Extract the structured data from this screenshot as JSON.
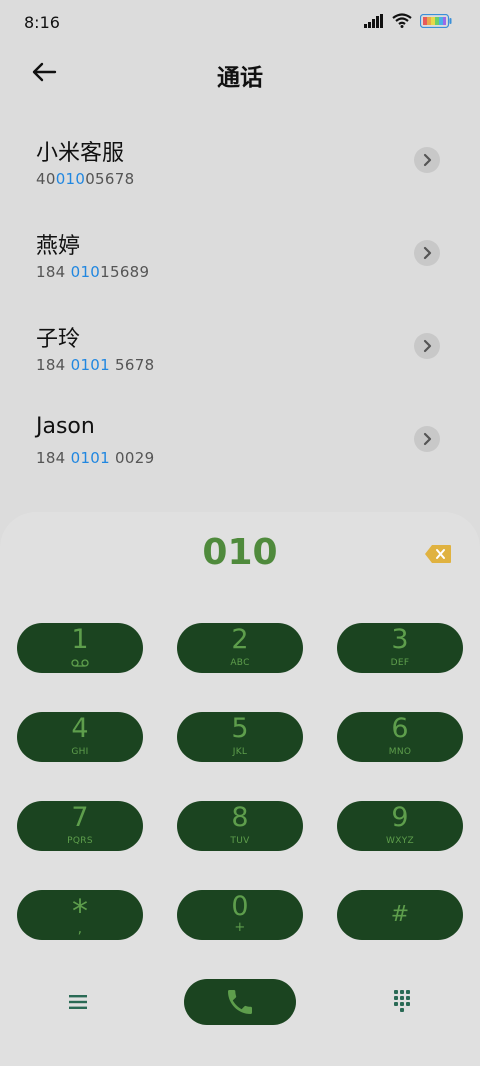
{
  "status": {
    "time": "8:16",
    "icons": [
      "signal-icon",
      "wifi-icon",
      "battery-icon"
    ]
  },
  "header": {
    "title": "通话",
    "back_icon": "arrow-left-icon"
  },
  "contacts": [
    {
      "name": "小米客服",
      "number_pre": "40",
      "number_hl": "010",
      "number_post": "05678"
    },
    {
      "name": "燕婷",
      "number_pre": "184 ",
      "number_hl": "010",
      "number_post": "15689"
    },
    {
      "name": "子玲",
      "number_pre": "184 ",
      "number_hl": "0101",
      "number_post": " 5678"
    },
    {
      "name": "Jason",
      "number_pre": "184 ",
      "number_hl": "0101",
      "number_post": " 0029"
    }
  ],
  "dialpad": {
    "digits": "010",
    "keys": [
      {
        "num": "1",
        "sub": ""
      },
      {
        "num": "2",
        "sub": "ABC"
      },
      {
        "num": "3",
        "sub": "DEF"
      },
      {
        "num": "4",
        "sub": "GHI"
      },
      {
        "num": "5",
        "sub": "JKL"
      },
      {
        "num": "6",
        "sub": "MNO"
      },
      {
        "num": "7",
        "sub": "PQRS"
      },
      {
        "num": "8",
        "sub": "TUV"
      },
      {
        "num": "9",
        "sub": "WXYZ"
      },
      {
        "num": "*",
        "sub": ","
      },
      {
        "num": "0",
        "sub": "+"
      },
      {
        "num": "#",
        "sub": ""
      }
    ]
  },
  "colors": {
    "key_bg": "#1b4420",
    "key_fg": "#5e9e4c",
    "digits": "#4f8a3c",
    "highlight": "#2187e0",
    "backspace": "#e0b240"
  }
}
